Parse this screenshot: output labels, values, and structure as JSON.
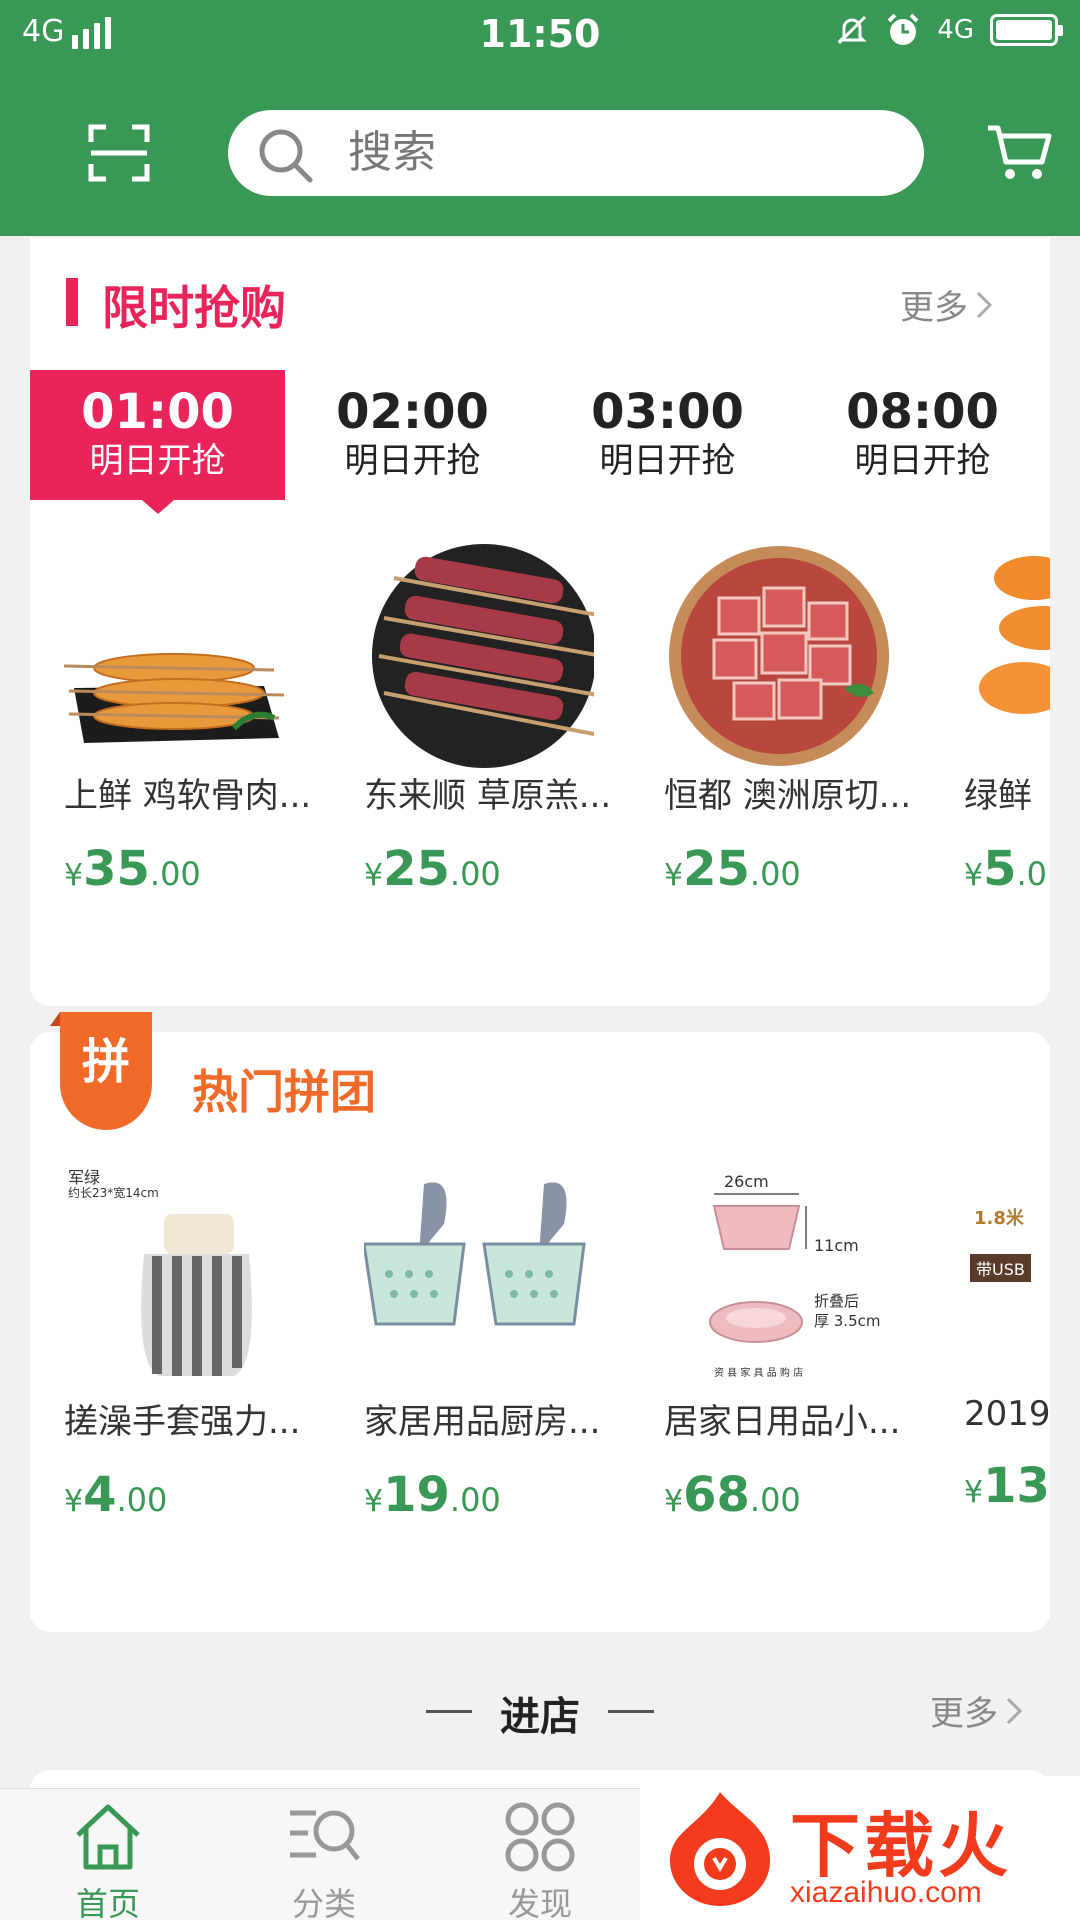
{
  "status_bar": {
    "network_left": "4G",
    "time": "11:50",
    "network_right": "4G"
  },
  "header": {
    "search_placeholder": "搜索"
  },
  "flash_sale": {
    "title": "限时抢购",
    "more": "更多",
    "slots": [
      {
        "time": "01:00",
        "label": "明日开抢",
        "active": true
      },
      {
        "time": "02:00",
        "label": "明日开抢",
        "active": false
      },
      {
        "time": "03:00",
        "label": "明日开抢",
        "active": false
      },
      {
        "time": "08:00",
        "label": "明日开抢",
        "active": false
      }
    ],
    "products": [
      {
        "name": "上鲜 鸡软骨肉...",
        "currency": "¥",
        "price_int": "35",
        "price_dec": ".00"
      },
      {
        "name": "东来顺 草原羔...",
        "currency": "¥",
        "price_int": "25",
        "price_dec": ".00"
      },
      {
        "name": "恒都 澳洲原切...",
        "currency": "¥",
        "price_int": "25",
        "price_dec": ".00"
      },
      {
        "name": "绿鲜",
        "currency": "¥",
        "price_int": "5",
        "price_dec": ".0"
      }
    ]
  },
  "group_buy": {
    "badge": "拼",
    "title": "热门拼团",
    "products": [
      {
        "name": "搓澡手套强力...",
        "currency": "¥",
        "price_int": "4",
        "price_dec": ".00",
        "img_label_1": "军绿",
        "img_label_2": "约长23*宽14cm"
      },
      {
        "name": "家居用品厨房...",
        "currency": "¥",
        "price_int": "19",
        "price_dec": ".00"
      },
      {
        "name": "居家日用品小...",
        "currency": "¥",
        "price_int": "68",
        "price_dec": ".00",
        "img_label_1": "26cm",
        "img_label_2": "11cm",
        "img_label_3": "折叠后",
        "img_label_4": "厚 3.5cm",
        "img_label_5": "资 县 家 具 品 购 店"
      },
      {
        "name": "2019",
        "currency": "¥",
        "price_int": "13",
        "price_dec": "",
        "img_label_1": "1.8米",
        "img_label_2": "带USB"
      }
    ]
  },
  "store_section": {
    "title": "进店",
    "more": "更多"
  },
  "bottom_nav": [
    {
      "label": "首页",
      "active": true
    },
    {
      "label": "分类",
      "active": false
    },
    {
      "label": "发现",
      "active": false
    }
  ],
  "watermark": {
    "text": "下载火",
    "sub": "xiazaihuo.com"
  },
  "colors": {
    "brand_green": "#3a9856",
    "flash_red": "#e8245a",
    "group_orange": "#f06a2a"
  }
}
